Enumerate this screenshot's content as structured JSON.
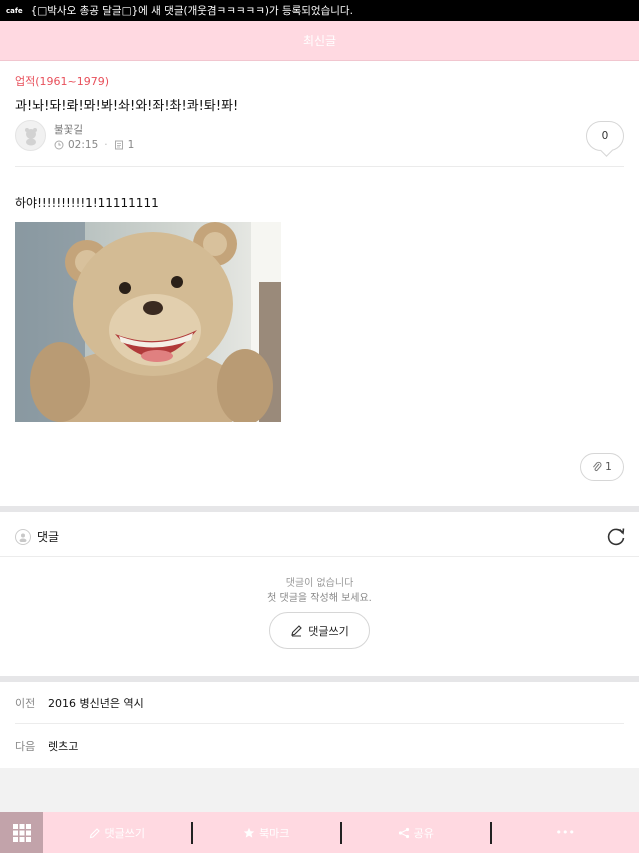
{
  "status_bar": {
    "app_tag": "cafe",
    "notification": "{□박사오 총공 달글□}에 새 댓글(개웃겸ㅋㅋㅋㅋㅋ)가 등록되었습니다."
  },
  "header": {
    "title": "최신글"
  },
  "article": {
    "category": "업적(1961~1979)",
    "title": "과!놔!돠!롸!뫄!봐!솨!와!좌!촤!콰!톼!퐈!",
    "author": "불꽃길",
    "time": "02:15",
    "views": "1",
    "comment_count": "0",
    "body_text": "하야!!!!!!!!!!1!11111111",
    "attachment_count": "1"
  },
  "comments": {
    "heading": "댓글",
    "empty_line1": "댓글이 없습니다",
    "empty_line2": "첫 댓글을 작성해 보세요.",
    "write_label": "댓글쓰기"
  },
  "navigation": {
    "prev_label": "이전",
    "prev_title": "2016 병신년은 역시",
    "next_label": "다음",
    "next_title": "렛츠고"
  },
  "bottom_bar": {
    "write_comment": "댓글쓰기",
    "bookmark": "북마크",
    "share": "공유",
    "more": "•••"
  },
  "colors": {
    "header_bg": "#ffd9e1",
    "category_red": "#e8505b",
    "grid_button_bg": "#c2a3aa"
  }
}
